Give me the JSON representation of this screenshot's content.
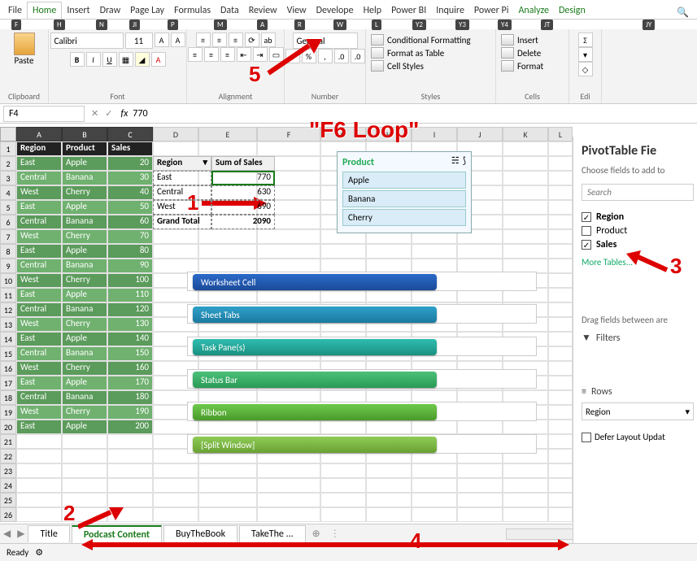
{
  "menu": {
    "file": "File",
    "home": "Home",
    "insert": "Insert",
    "draw": "Draw",
    "page": "Page Lay",
    "formulas": "Formulas",
    "data": "Data",
    "review": "Review",
    "view": "View",
    "dev": "Develope",
    "help": "Help",
    "pbi": "Power BI",
    "inq": "Inquire",
    "ppi": "Power Pi",
    "analyze": "Analyze",
    "design": "Design"
  },
  "keys": {
    "file": "F",
    "home": "H",
    "insert": "N",
    "draw": "JI",
    "page": "P",
    "formulas": "M",
    "data": "A",
    "review": "R",
    "view": "W",
    "dev": "L",
    "help": "Y2",
    "pbi": "Y3",
    "inq": "Y4",
    "ppi": "JT",
    "analyze": "JY"
  },
  "ribbon": {
    "paste": "Paste",
    "clipboard": "Clipboard",
    "font": "Font",
    "alignment": "Alignment",
    "number": "Number",
    "styles": "Styles",
    "cells": "Cells",
    "editing": "Edi",
    "fontName": "Calibri",
    "fontSize": "11",
    "numFormat": "General",
    "condFormat": "Conditional Formatting",
    "formatTable": "Format as Table",
    "cellStyles": "Cell Styles",
    "insert": "Insert",
    "delete": "Delete",
    "format": "Format"
  },
  "nameBox": "F4",
  "formula": "770",
  "headers": [
    "Region",
    "Product",
    "Sales"
  ],
  "rows": [
    [
      "East",
      "Apple",
      "20"
    ],
    [
      "Central",
      "Banana",
      "30"
    ],
    [
      "West",
      "Cherry",
      "40"
    ],
    [
      "East",
      "Apple",
      "50"
    ],
    [
      "Central",
      "Banana",
      "60"
    ],
    [
      "West",
      "Cherry",
      "70"
    ],
    [
      "East",
      "Apple",
      "80"
    ],
    [
      "Central",
      "Banana",
      "90"
    ],
    [
      "West",
      "Cherry",
      "100"
    ],
    [
      "East",
      "Apple",
      "110"
    ],
    [
      "Central",
      "Banana",
      "120"
    ],
    [
      "West",
      "Cherry",
      "130"
    ],
    [
      "East",
      "Apple",
      "140"
    ],
    [
      "Central",
      "Banana",
      "150"
    ],
    [
      "West",
      "Cherry",
      "160"
    ],
    [
      "East",
      "Apple",
      "170"
    ],
    [
      "Central",
      "Banana",
      "180"
    ],
    [
      "West",
      "Cherry",
      "190"
    ],
    [
      "East",
      "Apple",
      "200"
    ]
  ],
  "pivot": {
    "hdrRegion": "Region",
    "hdrSum": "Sum of Sales",
    "r": [
      [
        "East",
        "770"
      ],
      [
        "Central",
        "630"
      ],
      [
        "West",
        "690"
      ]
    ],
    "grandLabel": "Grand Total",
    "grandVal": "2090"
  },
  "slicer": {
    "title": "Product",
    "items": [
      "Apple",
      "Banana",
      "Cherry"
    ]
  },
  "flow": [
    "Worksheet Cell",
    "Sheet Tabs",
    "Task Pane(s)",
    "Status Bar",
    "Ribbon",
    "[Split Window]"
  ],
  "sheets": {
    "tab1": "Title",
    "tab2": "Podcast Content",
    "tab3": "BuyTheBook",
    "tab4": "TakeThe",
    "more": "..."
  },
  "status": "Ready",
  "taskpane": {
    "title": "PivotTable Fie",
    "sub": "Choose fields to add to",
    "searchPh": "Search",
    "f1": "Region",
    "f2": "Product",
    "f3": "Sales",
    "more": "More Tables...",
    "drag": "Drag fields between are",
    "filters": "Filters",
    "rowsLabel": "Rows",
    "rowField": "Region",
    "defer": "Defer Layout Updat"
  },
  "anno": {
    "title": "\"F6 Loop\"",
    "n1": "1",
    "n2": "2",
    "n3": "3",
    "n4": "4",
    "n5": "5"
  },
  "chart_data": {
    "type": "table",
    "description": "PivotTable Sum of Sales by Region",
    "categories": [
      "East",
      "Central",
      "West"
    ],
    "values": [
      770,
      630,
      690
    ],
    "grand_total": 2090,
    "source_table": {
      "columns": [
        "Region",
        "Product",
        "Sales"
      ],
      "rows": [
        [
          "East",
          "Apple",
          20
        ],
        [
          "Central",
          "Banana",
          30
        ],
        [
          "West",
          "Cherry",
          40
        ],
        [
          "East",
          "Apple",
          50
        ],
        [
          "Central",
          "Banana",
          60
        ],
        [
          "West",
          "Cherry",
          70
        ],
        [
          "East",
          "Apple",
          80
        ],
        [
          "Central",
          "Banana",
          90
        ],
        [
          "West",
          "Cherry",
          100
        ],
        [
          "East",
          "Apple",
          110
        ],
        [
          "Central",
          "Banana",
          120
        ],
        [
          "West",
          "Cherry",
          130
        ],
        [
          "East",
          "Apple",
          140
        ],
        [
          "Central",
          "Banana",
          150
        ],
        [
          "West",
          "Cherry",
          160
        ],
        [
          "East",
          "Apple",
          170
        ],
        [
          "Central",
          "Banana",
          180
        ],
        [
          "West",
          "Cherry",
          190
        ],
        [
          "East",
          "Apple",
          200
        ]
      ]
    }
  }
}
